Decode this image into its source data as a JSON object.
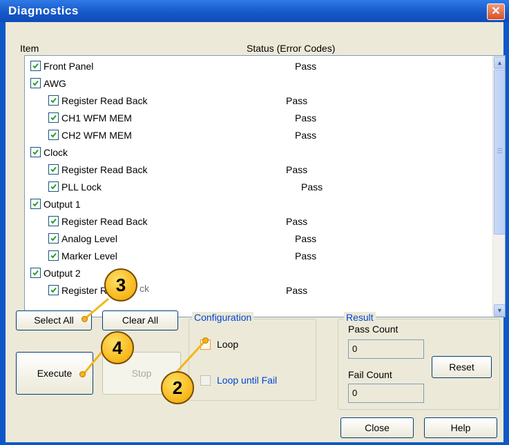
{
  "window": {
    "title": "Diagnostics",
    "close_glyph": "✕"
  },
  "columns": {
    "item": "Item",
    "status": "Status (Error Codes)"
  },
  "items": [
    {
      "label": "Front Panel",
      "status": "Pass",
      "checked": true
    },
    {
      "label": "AWG",
      "status": "",
      "checked": true
    },
    {
      "label": "Register Read Back",
      "status": "Pass",
      "checked": true
    },
    {
      "label": "CH1 WFM MEM",
      "status": "Pass",
      "checked": true
    },
    {
      "label": "CH2 WFM MEM",
      "status": "Pass",
      "checked": true
    },
    {
      "label": "Clock",
      "status": "",
      "checked": true
    },
    {
      "label": "Register Read Back",
      "status": "Pass",
      "checked": true
    },
    {
      "label": "PLL Lock",
      "status": "Pass",
      "checked": true
    },
    {
      "label": "Output 1",
      "status": "",
      "checked": true
    },
    {
      "label": "Register Read Back",
      "status": "Pass",
      "checked": true
    },
    {
      "label": "Analog Level",
      "status": "Pass",
      "checked": true
    },
    {
      "label": "Marker Level",
      "status": "Pass",
      "checked": true
    },
    {
      "label": "Output 2",
      "status": "",
      "checked": true
    },
    {
      "label": "Register R",
      "status": "Pass",
      "checked": true
    }
  ],
  "partial_text_right": "ck",
  "buttons": {
    "select_all": "Select All",
    "clear_all": "Clear All",
    "execute": "Execute",
    "stop": "Stop",
    "reset": "Reset",
    "close": "Close",
    "help": "Help"
  },
  "configuration": {
    "label": "Configuration",
    "loop": "Loop",
    "loop_until_fail": "Loop until Fail",
    "loop_checked": false,
    "loop_until_fail_checked": false
  },
  "result": {
    "label": "Result",
    "pass_count_label": "Pass Count",
    "pass_count": "0",
    "fail_count_label": "Fail Count",
    "fail_count": "0"
  },
  "callouts": {
    "c3": "3",
    "c4": "4",
    "c2": "2"
  },
  "icons": {
    "checkbox": "checkmark-icon",
    "scroll_up": "chevron-up-icon",
    "scroll_down": "chevron-down-icon",
    "close": "close-icon"
  }
}
